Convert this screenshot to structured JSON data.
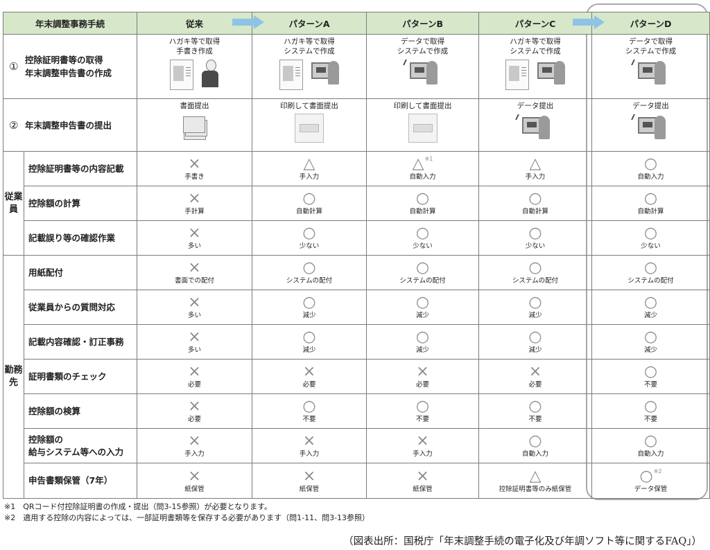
{
  "header": [
    "年末調整事務手続",
    "従来",
    "パターンA",
    "パターンB",
    "パターンC",
    "パターンD"
  ],
  "row1": {
    "num": "①",
    "label_lines": [
      "控除証明書等の取得",
      "年末調整申告書の作成"
    ],
    "cells": [
      {
        "lines": [
          "ハガキ等で取得",
          "手書き作成"
        ],
        "illustration": "document-and-person-icon",
        "doc_label": "控除証明書"
      },
      {
        "lines": [
          "ハガキ等で取得",
          "システムで作成"
        ],
        "illustration": "document-and-computer-icon",
        "doc_label": "控除証明書"
      },
      {
        "lines": [
          "データで取得",
          "システムで作成"
        ],
        "illustration": "computer-icon"
      },
      {
        "lines": [
          "ハガキ等で取得",
          "システムで作成"
        ],
        "illustration": "document-and-computer-icon",
        "doc_label": "控除証明書"
      },
      {
        "lines": [
          "データで取得",
          "システムで作成"
        ],
        "illustration": "computer-icon"
      }
    ]
  },
  "row2": {
    "num": "②",
    "label": "年末調整申告書の提出",
    "cells": [
      {
        "text": "書面提出",
        "illustration": "paper-stack-icon"
      },
      {
        "text": "印刷して書面提出",
        "illustration": "printer-icon"
      },
      {
        "text": "印刷して書面提出",
        "illustration": "printer-icon"
      },
      {
        "text": "データ提出",
        "illustration": "computer-icon"
      },
      {
        "text": "データ提出",
        "illustration": "computer-icon"
      }
    ]
  },
  "groups": {
    "employee": "従業員",
    "employer": "勤務先"
  },
  "rows": [
    {
      "label": "控除証明書等の内容記載",
      "cells": [
        {
          "sym": "×",
          "text": "手書き"
        },
        {
          "sym": "△",
          "text": "手入力"
        },
        {
          "sym": "△",
          "text": "自動入力",
          "note": "※1"
        },
        {
          "sym": "△",
          "text": "手入力"
        },
        {
          "sym": "○",
          "text": "自動入力"
        }
      ]
    },
    {
      "label": "控除額の計算",
      "cells": [
        {
          "sym": "×",
          "text": "手計算"
        },
        {
          "sym": "○",
          "text": "自動計算"
        },
        {
          "sym": "○",
          "text": "自動計算"
        },
        {
          "sym": "○",
          "text": "自動計算"
        },
        {
          "sym": "○",
          "text": "自動計算"
        }
      ]
    },
    {
      "label": "記載誤り等の確認作業",
      "cells": [
        {
          "sym": "×",
          "text": "多い"
        },
        {
          "sym": "○",
          "text": "少ない"
        },
        {
          "sym": "○",
          "text": "少ない"
        },
        {
          "sym": "○",
          "text": "少ない"
        },
        {
          "sym": "○",
          "text": "少ない"
        }
      ]
    },
    {
      "label": "用紙配付",
      "cells": [
        {
          "sym": "×",
          "text": "書面での配付"
        },
        {
          "sym": "○",
          "text": "システムの配付"
        },
        {
          "sym": "○",
          "text": "システムの配付"
        },
        {
          "sym": "○",
          "text": "システムの配付"
        },
        {
          "sym": "○",
          "text": "システムの配付"
        }
      ]
    },
    {
      "label": "従業員からの質問対応",
      "cells": [
        {
          "sym": "×",
          "text": "多い"
        },
        {
          "sym": "○",
          "text": "減少"
        },
        {
          "sym": "○",
          "text": "減少"
        },
        {
          "sym": "○",
          "text": "減少"
        },
        {
          "sym": "○",
          "text": "減少"
        }
      ]
    },
    {
      "label": "記載内容確認・訂正事務",
      "cells": [
        {
          "sym": "×",
          "text": "多い"
        },
        {
          "sym": "○",
          "text": "減少"
        },
        {
          "sym": "○",
          "text": "減少"
        },
        {
          "sym": "○",
          "text": "減少"
        },
        {
          "sym": "○",
          "text": "減少"
        }
      ]
    },
    {
      "label": "証明書類のチェック",
      "cells": [
        {
          "sym": "×",
          "text": "必要"
        },
        {
          "sym": "×",
          "text": "必要"
        },
        {
          "sym": "×",
          "text": "必要"
        },
        {
          "sym": "×",
          "text": "必要"
        },
        {
          "sym": "○",
          "text": "不要"
        }
      ]
    },
    {
      "label": "控除額の検算",
      "cells": [
        {
          "sym": "×",
          "text": "必要"
        },
        {
          "sym": "○",
          "text": "不要"
        },
        {
          "sym": "○",
          "text": "不要"
        },
        {
          "sym": "○",
          "text": "不要"
        },
        {
          "sym": "○",
          "text": "不要"
        }
      ]
    },
    {
      "label": "控除額の\n給与システム等への入力",
      "cells": [
        {
          "sym": "×",
          "text": "手入力"
        },
        {
          "sym": "×",
          "text": "手入力"
        },
        {
          "sym": "×",
          "text": "手入力"
        },
        {
          "sym": "○",
          "text": "自動入力"
        },
        {
          "sym": "○",
          "text": "自動入力"
        }
      ]
    },
    {
      "label": "申告書類保管（7年）",
      "cells": [
        {
          "sym": "×",
          "text": "紙保管"
        },
        {
          "sym": "×",
          "text": "紙保管"
        },
        {
          "sym": "×",
          "text": "紙保管"
        },
        {
          "sym": "△",
          "text": "控除証明書等のみ紙保管"
        },
        {
          "sym": "○",
          "text": "データ保管",
          "note": "※2"
        }
      ]
    }
  ],
  "footnotes": [
    "※1　QRコード付控除証明書の作成・提出（問3-15参照）が必要となります。",
    "※2　適用する控除の内容によっては、一部証明書類等を保存する必要があります（問1-11、問3-13参照）"
  ],
  "source": "（図表出所：国税庁「年末調整手続の電子化及び年調ソフト等に関するFAQ」）",
  "colors": {
    "header_bg": "#d6e8c9",
    "arrow": "#8ec3e6",
    "highlight_border": "#a8a8a8"
  }
}
